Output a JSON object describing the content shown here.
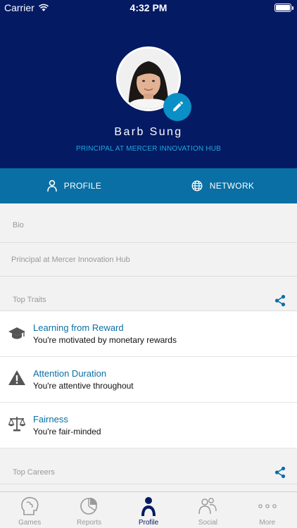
{
  "status_bar": {
    "carrier": "Carrier",
    "time": "4:32 PM"
  },
  "profile": {
    "name": "Barb Sung",
    "subtitle": "PRINCIPAL AT MERCER INNOVATION HUB"
  },
  "tabs": [
    {
      "label": "PROFILE",
      "icon": "person-icon"
    },
    {
      "label": "NETWORK",
      "icon": "globe-icon"
    }
  ],
  "bio": {
    "label": "Bio",
    "text": "Principal at Mercer Innovation Hub"
  },
  "top_traits": {
    "label": "Top Traits",
    "items": [
      {
        "title": "Learning from Reward",
        "desc": "You're motivated by monetary rewards",
        "icon": "graduation-cap-icon"
      },
      {
        "title": "Attention Duration",
        "desc": "You're attentive throughout",
        "icon": "warning-icon"
      },
      {
        "title": "Fairness",
        "desc": "You're fair-minded",
        "icon": "scales-icon"
      }
    ]
  },
  "top_careers": {
    "label": "Top Careers"
  },
  "tab_bar": [
    {
      "label": "Games",
      "icon": "brain-icon"
    },
    {
      "label": "Reports",
      "icon": "pie-chart-icon"
    },
    {
      "label": "Profile",
      "icon": "person-icon"
    },
    {
      "label": "Social",
      "icon": "people-icon"
    },
    {
      "label": "More",
      "icon": "more-icon"
    }
  ],
  "colors": {
    "header_bg": "#041a63",
    "tab_bg": "#0a6fa4",
    "accent": "#0a8fc6",
    "link": "#0a6fa4"
  }
}
